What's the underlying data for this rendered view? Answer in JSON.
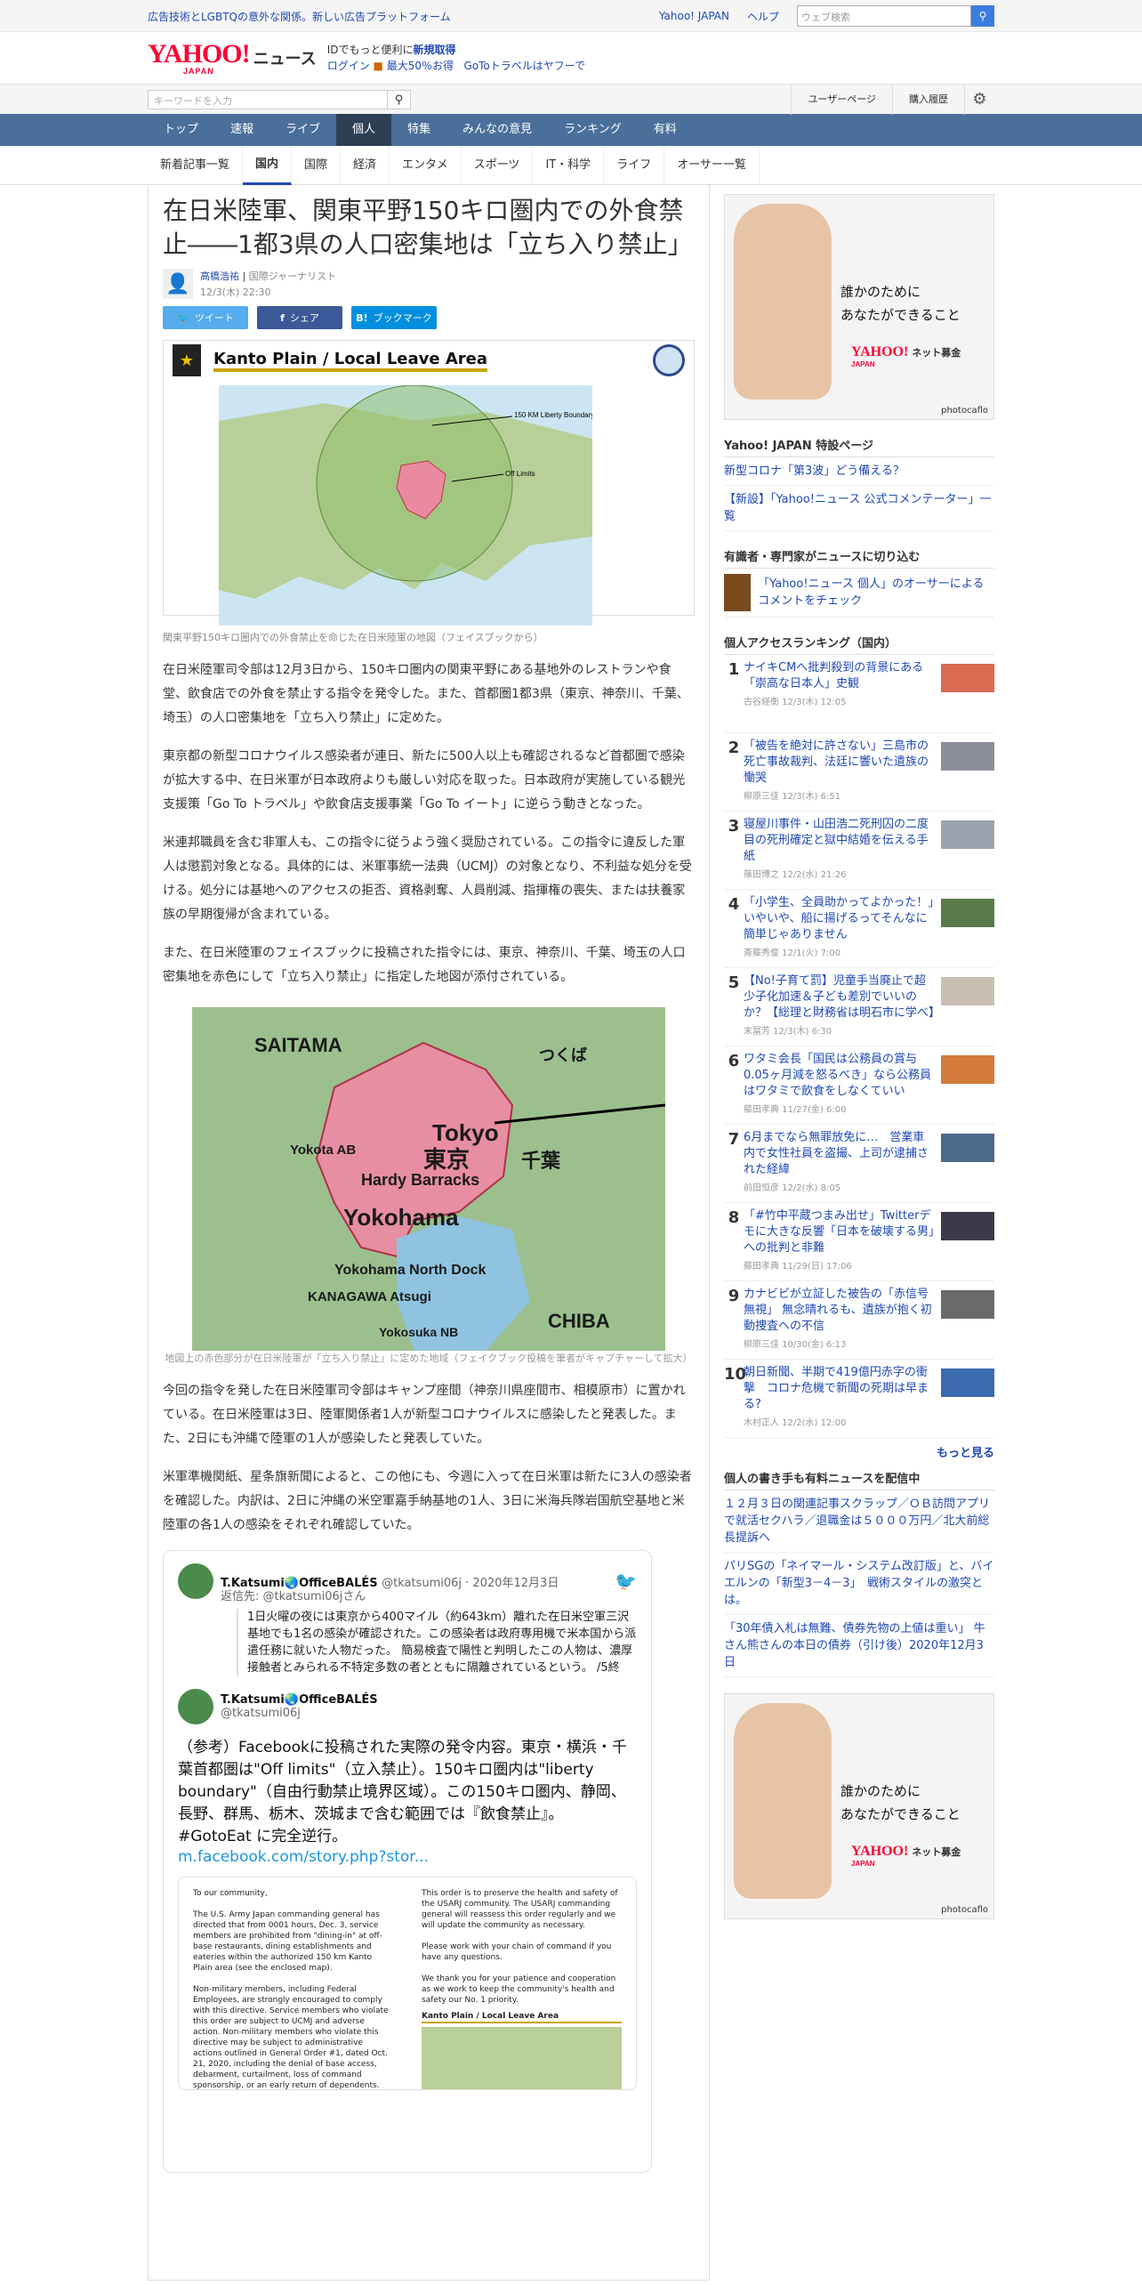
{
  "topbar": {
    "promo": "広告技術とLGBTQの意外な関係。新しい広告プラットフォーム",
    "yahoo_japan": "Yahoo! JAPAN",
    "help": "ヘルプ",
    "search_placeholder": "ウェブ検索"
  },
  "header": {
    "logo": "YAHOO!",
    "logo_sub": "JAPAN",
    "news": "ニュース",
    "line1_prefix": "IDでもっと便利に",
    "line1_link": "新規取得",
    "line2_login": "ログイン",
    "line2_promo": "最大50％お得",
    "line2_goto": "GoToトラベルはヤフーで"
  },
  "searchrow": {
    "placeholder": "キーワードを入力",
    "user_page": "ユーザーページ",
    "purchase_history": "購入履歴"
  },
  "nav": {
    "items": [
      "トップ",
      "速報",
      "ライブ",
      "個人",
      "特集",
      "みんなの意見",
      "ランキング",
      "有料"
    ],
    "current": "個人"
  },
  "subnav": {
    "items": [
      "新着記事一覧",
      "国内",
      "国際",
      "経済",
      "エンタメ",
      "スポーツ",
      "IT・科学",
      "ライフ",
      "オーサー一覧"
    ],
    "current": "国内"
  },
  "article": {
    "title": "在日米陸軍、関東平野150キロ圏内での外食禁止――1都3県の人口密集地は「立ち入り禁止」",
    "author_name": "高橋浩祐",
    "author_role": "国際ジャーナリスト",
    "date": "12/3(木) 22:30",
    "share": {
      "twitter": "ツイート",
      "facebook": "シェア",
      "hatena": "ブックマーク"
    },
    "map1_title": "Kanto Plain / Local Leave Area",
    "map1_labels": [
      "150 KM Liberty Boundary",
      "Off Limits"
    ],
    "map1_caption": "関東平野150キロ圏内での外食禁止を命じた在日米陸軍の地図（フェイスブックから）",
    "p1": "在日米陸軍司令部は12月3日から、150キロ圏内の関東平野にある基地外のレストランや食堂、飲食店での外食を禁止する指令を発令した。また、首都圏1都3県（東京、神奈川、千葉、埼玉）の人口密集地を「立ち入り禁止」に定めた。",
    "p2": "東京都の新型コロナウイルス感染者が連日、新たに500人以上も確認されるなど首都圏で感染が拡大する中、在日米軍が日本政府よりも厳しい対応を取った。日本政府が実施している観光支援策「Go To トラベル」や飲食店支援事業「Go To イート」に逆らう動きとなった。",
    "p3": "米連邦職員を含む非軍人も、この指令に従うよう強く奨励されている。この指令に違反した軍人は懲罰対象となる。具体的には、米軍事統一法典（UCMJ）の対象となり、不利益な処分を受ける。処分には基地へのアクセスの拒否、資格剥奪、人員削減、指揮権の喪失、または扶養家族の早期復帰が含まれている。",
    "p4": "また、在日米陸軍のフェイスブックに投稿された指令には、東京、神奈川、千葉、埼玉の人口密集地を赤色にして「立ち入り禁止」に指定した地図が添付されている。",
    "map2_labels": [
      "SAITAMA",
      "Tokyo",
      "東京",
      "Yokota AB",
      "Hardy Barracks",
      "Yokohama",
      "Yokohama North Dock",
      "KANAGAWA Atsugi",
      "Yokosuka NB",
      "CHIBA",
      "千葉",
      "つくば"
    ],
    "map2_caption": "地図上の赤色部分が在日米陸軍が「立ち入り禁止」に定めた地域（フェイクブック投稿を筆者がキャプチャーして拡大）",
    "p5": "今回の指令を発した在日米陸軍司令部はキャンプ座間（神奈川県座間市、相模原市）に置かれている。在日米陸軍は3日、陸軍関係者1人が新型コロナウイルスに感染したと発表した。また、2日にも沖縄で陸軍の1人が感染したと発表していた。",
    "p6": "米軍準機関紙、星条旗新聞によると、この他にも、今週に入って在日米軍は新たに3人の感染者を確認した。内訳は、2日に沖縄の米空軍嘉手納基地の1人、3日に米海兵隊岩国航空基地と米陸軍の各1人の感染をそれぞれ確認していた。"
  },
  "tweet": {
    "name": "T.Katsumi🌏OfficeBALÉS",
    "handle": "@tkatsumi06j",
    "date": "2020年12月3日",
    "reply_to": "返信先: @tkatsumi06jさん",
    "quoted": "1日火曜の夜には東京から400マイル（約643km）離れた在日米空軍三沢基地でも1名の感染が確認された。この感染者は政府専用機で米本国から派遣任務に就いた人物だった。 簡易検査で陽性と判明したこの人物は、濃厚接触者とみられる不特定多数の者とともに隔離されているという。 /5終",
    "handle2": "@tkatsumi06j",
    "body": "（参考）Facebookに投稿された実際の発令内容。東京・横浜・千葉首都圏は\"Off limits\"（立入禁止）。150キロ圏内は\"liberty boundary\"（自由行動禁止境界区域）。この150キロ圏内、静岡、長野、群馬、栃木、茨城まで含む範囲では『飲食禁止』。 #GotoEat に完全逆行。",
    "link": "m.facebook.com/story.php?stor...",
    "img_left": "To our community,\n\nThe U.S. Army Japan commanding general has directed that from 0001 hours, Dec. 3, service members are prohibited from \"dining-in\" at off-base restaurants, dining establishments and eateries within the authorized 150 km Kanto Plain area (see the enclosed map).\n\nNon-military members, including Federal Employees, are strongly encouraged to comply with this directive. Service members who violate this order are subject to UCMJ and adverse action. Non-military members who violate this directive may be subject to administrative actions outlined in General Order #1, dated Oct. 21, 2020, including the denial of base access, debarment, curtailment, loss of command sponsorship, or an early return of dependents.\n\nThis order is to preserve the health and safety of the USARJ community. The USARJ commanding general",
    "img_right": "This order is to preserve the health and safety of the USARJ community. The USARJ commanding general will reassess this order regularly and we will update the community as necessary.\n\nPlease work with your chain of command if you have any questions.\n\nWe thank you for your patience and cooperation as we work to keep the community's health and safety our No. 1 priority.",
    "img_map_title": "Kanto Plain / Local Leave Area"
  },
  "sidebar": {
    "ad": {
      "line1": "誰かのために",
      "line2": "あなたができること",
      "brand": "YAHOO!",
      "brand_sub": "JAPAN",
      "brand_tail": "ネット募金",
      "credit": "photocaflo"
    },
    "special_heading": "Yahoo! JAPAN 特設ページ",
    "special_links": [
      "新型コロナ「第3波」どう備える？",
      "【新設】「Yahoo!ニュース 公式コメンテーター」一覧"
    ],
    "experts_heading": "有識者・専門家がニュースに切り込む",
    "experts_link": "「Yahoo!ニュース 個人」のオーサーによるコメントをチェック",
    "ranking_heading": "個人アクセスランキング（国内）",
    "ranking": [
      {
        "n": "1",
        "title": "ナイキCMへ批判殺到の背景にある「崇高な日本人」史観",
        "meta": "古谷経衡 12/3(木) 12:05"
      },
      {
        "n": "2",
        "title": "「被告を絶対に許さない」三島市の死亡事故裁判、法廷に響いた遺族の慟哭",
        "meta": "柳原三佳 12/3(木) 6:51"
      },
      {
        "n": "3",
        "title": "寝屋川事件・山田浩二死刑囚の二度目の死刑確定と獄中結婚を伝える手紙",
        "meta": "篠田博之 12/2(水) 21:26"
      },
      {
        "n": "4",
        "title": "「小学生、全員助かってよかった！」　いやいや、船に揚げるってそんなに簡単じゃありません",
        "meta": "斎藤秀俊 12/1(火) 7:00"
      },
      {
        "n": "5",
        "title": "【No!子育て罰】児童手当廃止で超少子化加速＆子ども差別でいいのか？【総理と財務省は明石市に学べ】",
        "meta": "末冨芳 12/3(木) 6:30"
      },
      {
        "n": "6",
        "title": "ワタミ会長「国民は公務員の賞与0.05ヶ月減を怒るべき」なら公務員はワタミで飲食をしなくていい",
        "meta": "藤田孝典 11/27(金) 6:00"
      },
      {
        "n": "7",
        "title": "6月までなら無罪放免に…　営業車内で女性社員を盗撮、上司が逮捕された経緯",
        "meta": "前田恒彦 12/2(水) 8:05"
      },
      {
        "n": "8",
        "title": "「#竹中平蔵つまみ出せ」Twitterデモに大きな反響「日本を破壊する男」への批判と非難",
        "meta": "藤田孝典 11/29(日) 17:06"
      },
      {
        "n": "9",
        "title": "カナビビが立証した被告の「赤信号無視」 無念晴れるも、遺族が抱く初動捜査への不信",
        "meta": "柳原三佳 10/30(金) 6:13"
      },
      {
        "n": "10",
        "title": "朝日新聞、半期で419億円赤字の衝撃　コロナ危機で新聞の死期は早まる?",
        "meta": "木村正人 12/2(水) 12:00"
      }
    ],
    "more": "もっと見る",
    "paid_heading": "個人の書き手も有料ニュースを配信中",
    "paid_links": [
      "１２月３日の関連記事スクラップ／ＯＢ訪問アプリで就活セクハラ／退職金は５０００万円／北大前総長提訴へ",
      "パリSGの「ネイマール・システム改訂版」と、バイエルンの「新型3－4－3」　戦術スタイルの激突とは。",
      "「30年債入札は無難、債券先物の上値は重い」 牛さん熊さんの本日の債券（引け後）2020年12月3日"
    ]
  }
}
